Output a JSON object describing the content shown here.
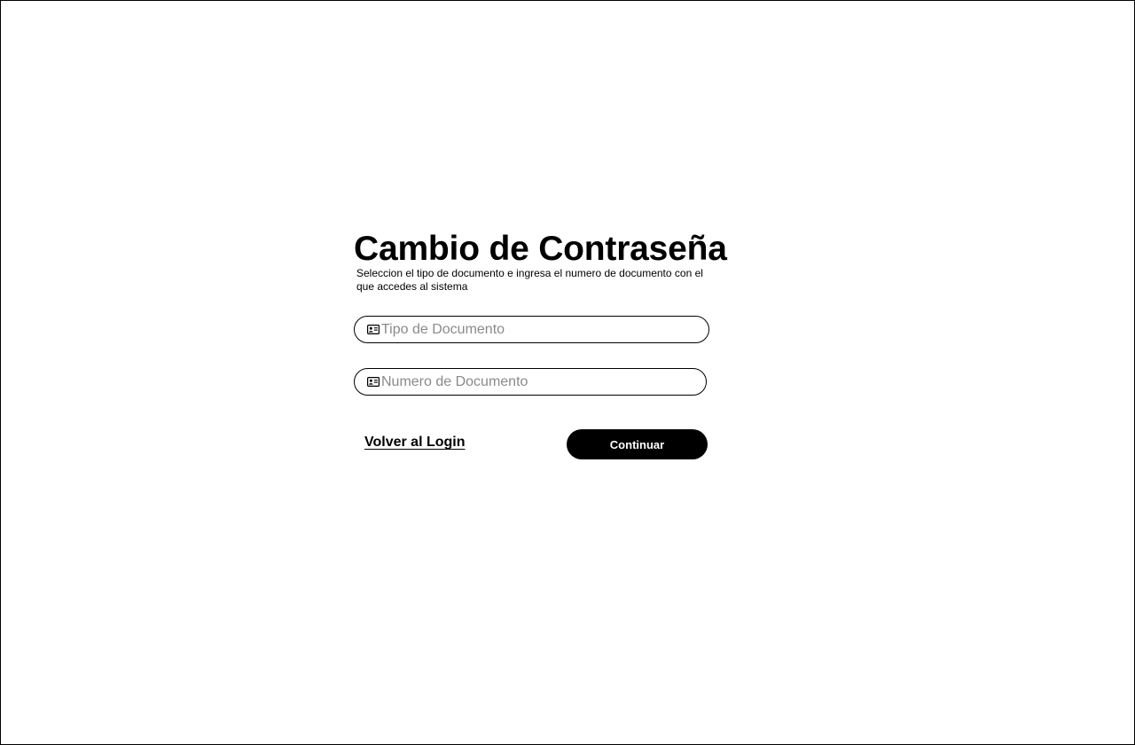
{
  "page": {
    "title": "Cambio de Contraseña",
    "subtitle": "Seleccion el tipo de documento e ingresa el numero de documento con el que accedes al sistema"
  },
  "form": {
    "document_type": {
      "placeholder": "Tipo de Documento",
      "value": "",
      "icon": "id-card-icon"
    },
    "document_number": {
      "placeholder": "Numero de Documento",
      "value": "",
      "icon": "id-card-icon"
    }
  },
  "actions": {
    "back_label": "Volver al Login",
    "continue_label": "Continuar"
  },
  "colors": {
    "primary": "#000000",
    "background": "#ffffff",
    "placeholder": "#8a8a8a"
  }
}
